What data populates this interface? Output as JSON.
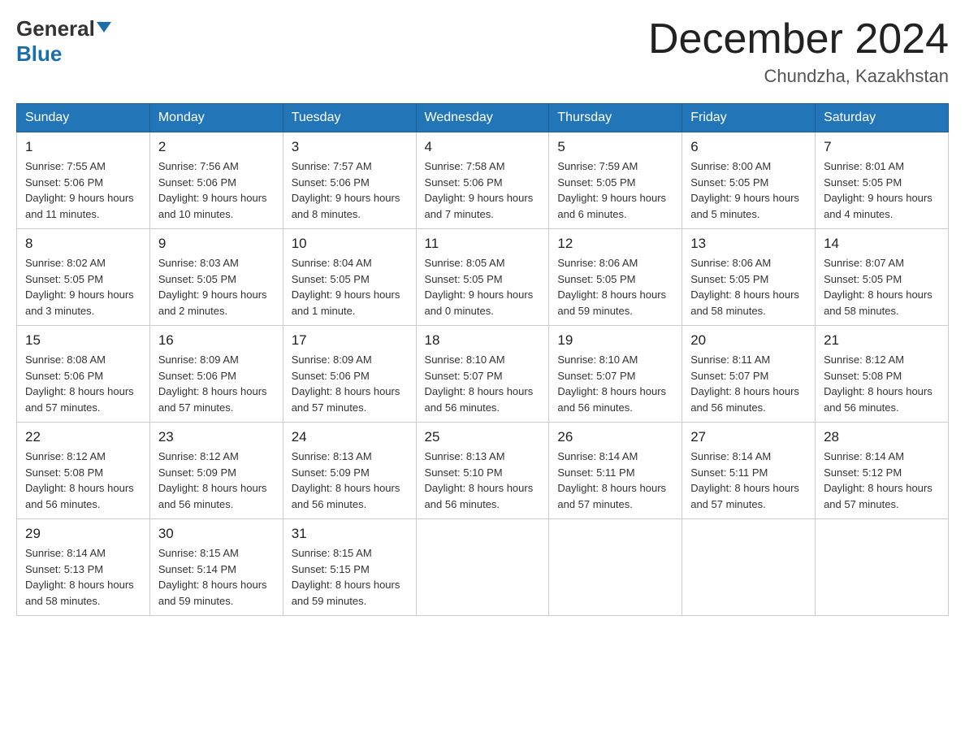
{
  "header": {
    "logo_general": "General",
    "logo_blue": "Blue",
    "month_title": "December 2024",
    "location": "Chundzha, Kazakhstan"
  },
  "calendar": {
    "days_of_week": [
      "Sunday",
      "Monday",
      "Tuesday",
      "Wednesday",
      "Thursday",
      "Friday",
      "Saturday"
    ],
    "weeks": [
      [
        {
          "day": "1",
          "sunrise": "7:55 AM",
          "sunset": "5:06 PM",
          "daylight": "9 hours and 11 minutes."
        },
        {
          "day": "2",
          "sunrise": "7:56 AM",
          "sunset": "5:06 PM",
          "daylight": "9 hours and 10 minutes."
        },
        {
          "day": "3",
          "sunrise": "7:57 AM",
          "sunset": "5:06 PM",
          "daylight": "9 hours and 8 minutes."
        },
        {
          "day": "4",
          "sunrise": "7:58 AM",
          "sunset": "5:06 PM",
          "daylight": "9 hours and 7 minutes."
        },
        {
          "day": "5",
          "sunrise": "7:59 AM",
          "sunset": "5:05 PM",
          "daylight": "9 hours and 6 minutes."
        },
        {
          "day": "6",
          "sunrise": "8:00 AM",
          "sunset": "5:05 PM",
          "daylight": "9 hours and 5 minutes."
        },
        {
          "day": "7",
          "sunrise": "8:01 AM",
          "sunset": "5:05 PM",
          "daylight": "9 hours and 4 minutes."
        }
      ],
      [
        {
          "day": "8",
          "sunrise": "8:02 AM",
          "sunset": "5:05 PM",
          "daylight": "9 hours and 3 minutes."
        },
        {
          "day": "9",
          "sunrise": "8:03 AM",
          "sunset": "5:05 PM",
          "daylight": "9 hours and 2 minutes."
        },
        {
          "day": "10",
          "sunrise": "8:04 AM",
          "sunset": "5:05 PM",
          "daylight": "9 hours and 1 minute."
        },
        {
          "day": "11",
          "sunrise": "8:05 AM",
          "sunset": "5:05 PM",
          "daylight": "9 hours and 0 minutes."
        },
        {
          "day": "12",
          "sunrise": "8:06 AM",
          "sunset": "5:05 PM",
          "daylight": "8 hours and 59 minutes."
        },
        {
          "day": "13",
          "sunrise": "8:06 AM",
          "sunset": "5:05 PM",
          "daylight": "8 hours and 58 minutes."
        },
        {
          "day": "14",
          "sunrise": "8:07 AM",
          "sunset": "5:05 PM",
          "daylight": "8 hours and 58 minutes."
        }
      ],
      [
        {
          "day": "15",
          "sunrise": "8:08 AM",
          "sunset": "5:06 PM",
          "daylight": "8 hours and 57 minutes."
        },
        {
          "day": "16",
          "sunrise": "8:09 AM",
          "sunset": "5:06 PM",
          "daylight": "8 hours and 57 minutes."
        },
        {
          "day": "17",
          "sunrise": "8:09 AM",
          "sunset": "5:06 PM",
          "daylight": "8 hours and 57 minutes."
        },
        {
          "day": "18",
          "sunrise": "8:10 AM",
          "sunset": "5:07 PM",
          "daylight": "8 hours and 56 minutes."
        },
        {
          "day": "19",
          "sunrise": "8:10 AM",
          "sunset": "5:07 PM",
          "daylight": "8 hours and 56 minutes."
        },
        {
          "day": "20",
          "sunrise": "8:11 AM",
          "sunset": "5:07 PM",
          "daylight": "8 hours and 56 minutes."
        },
        {
          "day": "21",
          "sunrise": "8:12 AM",
          "sunset": "5:08 PM",
          "daylight": "8 hours and 56 minutes."
        }
      ],
      [
        {
          "day": "22",
          "sunrise": "8:12 AM",
          "sunset": "5:08 PM",
          "daylight": "8 hours and 56 minutes."
        },
        {
          "day": "23",
          "sunrise": "8:12 AM",
          "sunset": "5:09 PM",
          "daylight": "8 hours and 56 minutes."
        },
        {
          "day": "24",
          "sunrise": "8:13 AM",
          "sunset": "5:09 PM",
          "daylight": "8 hours and 56 minutes."
        },
        {
          "day": "25",
          "sunrise": "8:13 AM",
          "sunset": "5:10 PM",
          "daylight": "8 hours and 56 minutes."
        },
        {
          "day": "26",
          "sunrise": "8:14 AM",
          "sunset": "5:11 PM",
          "daylight": "8 hours and 57 minutes."
        },
        {
          "day": "27",
          "sunrise": "8:14 AM",
          "sunset": "5:11 PM",
          "daylight": "8 hours and 57 minutes."
        },
        {
          "day": "28",
          "sunrise": "8:14 AM",
          "sunset": "5:12 PM",
          "daylight": "8 hours and 57 minutes."
        }
      ],
      [
        {
          "day": "29",
          "sunrise": "8:14 AM",
          "sunset": "5:13 PM",
          "daylight": "8 hours and 58 minutes."
        },
        {
          "day": "30",
          "sunrise": "8:15 AM",
          "sunset": "5:14 PM",
          "daylight": "8 hours and 59 minutes."
        },
        {
          "day": "31",
          "sunrise": "8:15 AM",
          "sunset": "5:15 PM",
          "daylight": "8 hours and 59 minutes."
        },
        null,
        null,
        null,
        null
      ]
    ]
  },
  "labels": {
    "sunrise": "Sunrise:",
    "sunset": "Sunset:",
    "daylight": "Daylight:"
  }
}
